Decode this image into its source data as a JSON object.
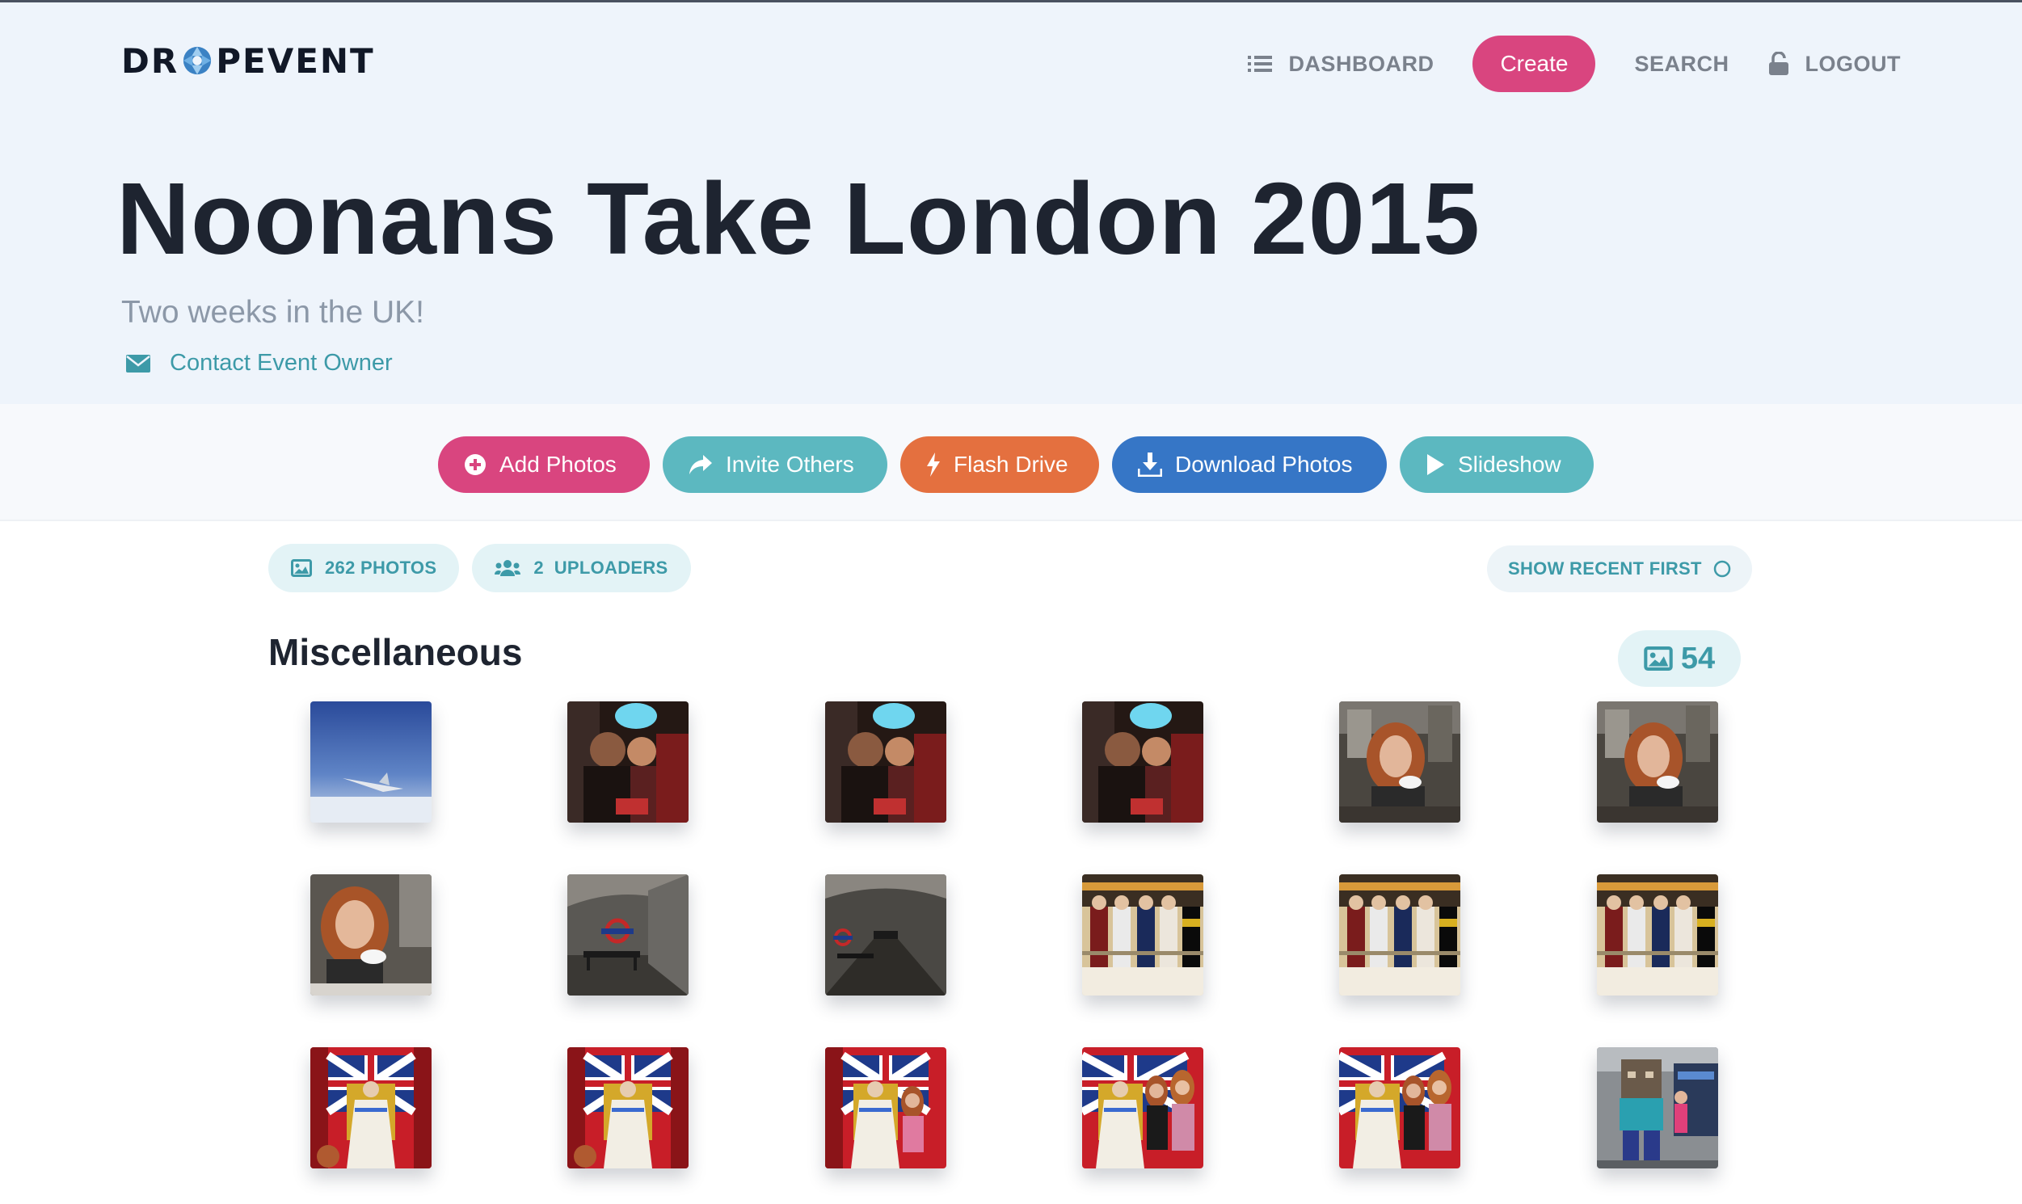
{
  "brand": {
    "logo_left": "DR",
    "logo_right": "PEVENT"
  },
  "nav": {
    "dashboard": "DASHBOARD",
    "create": "Create",
    "search": "SEARCH",
    "logout": "LOGOUT"
  },
  "event": {
    "title": "Noonans Take London 2015",
    "subtitle": "Two weeks in the UK!",
    "contact": "Contact Event Owner"
  },
  "actions": {
    "add_photos": "Add Photos",
    "invite_others": "Invite Others",
    "flash_drive": "Flash Drive",
    "download_photos": "Download Photos",
    "slideshow": "Slideshow"
  },
  "stats": {
    "photos": "262 PHOTOS",
    "uploaders": "2  UPLOADERS",
    "sort_toggle": "SHOW RECENT FIRST"
  },
  "section": {
    "title": "Miscellaneous",
    "count": "54"
  },
  "colors": {
    "accent_pink": "#d9457f",
    "accent_teal": "#5cb8c0",
    "accent_orange": "#e4703f",
    "accent_blue": "#3676c6",
    "hero_bg": "#eef4fb"
  },
  "photos": [
    {
      "scene": "sky-wing"
    },
    {
      "scene": "plane-cabin"
    },
    {
      "scene": "plane-cabin"
    },
    {
      "scene": "plane-cabin"
    },
    {
      "scene": "cafe-girl"
    },
    {
      "scene": "cafe-girl"
    },
    {
      "scene": "cafe-girl-close"
    },
    {
      "scene": "underground-platform"
    },
    {
      "scene": "underground-tunnel"
    },
    {
      "scene": "royal-waxworks"
    },
    {
      "scene": "royal-waxworks"
    },
    {
      "scene": "royal-waxworks"
    },
    {
      "scene": "queen-throne"
    },
    {
      "scene": "queen-throne"
    },
    {
      "scene": "queen-throne-girl"
    },
    {
      "scene": "queen-throne-girls"
    },
    {
      "scene": "queen-throne-girls"
    },
    {
      "scene": "lego-figure"
    }
  ]
}
